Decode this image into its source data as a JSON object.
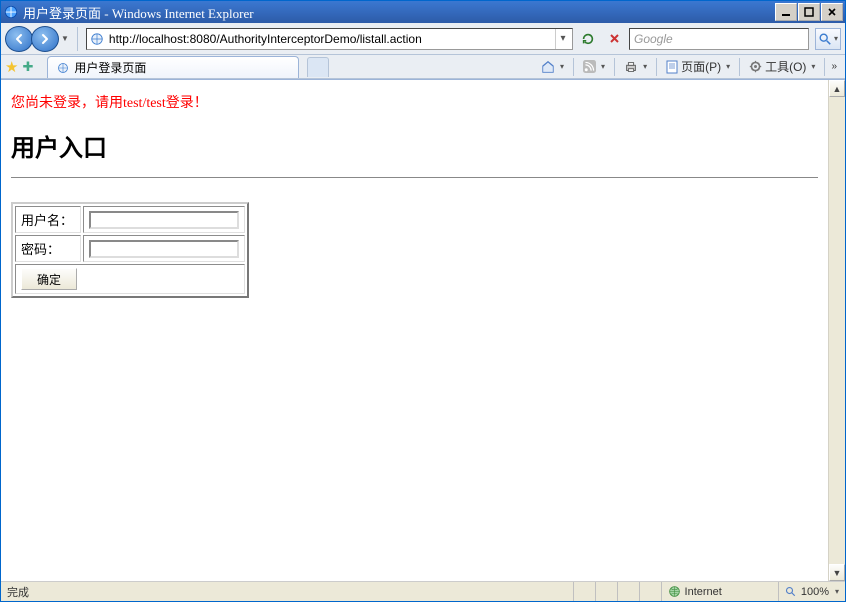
{
  "window": {
    "title": "用户登录页面 - Windows Internet Explorer"
  },
  "nav": {
    "url": "http://localhost:8080/AuthorityInterceptorDemo/listall.action",
    "search_placeholder": "Google"
  },
  "tab": {
    "label": "用户登录页面"
  },
  "commandbar": {
    "page_label": "页面(P)",
    "tools_label": "工具(O)"
  },
  "page": {
    "error_message": "您尚未登录，请用test/test登录！",
    "heading": "用户入口",
    "form": {
      "username_label": "用户名：",
      "password_label": "密码：",
      "submit_label": "确定",
      "username_value": "",
      "password_value": ""
    }
  },
  "statusbar": {
    "status": "完成",
    "zone": "Internet",
    "zoom": "100%"
  }
}
